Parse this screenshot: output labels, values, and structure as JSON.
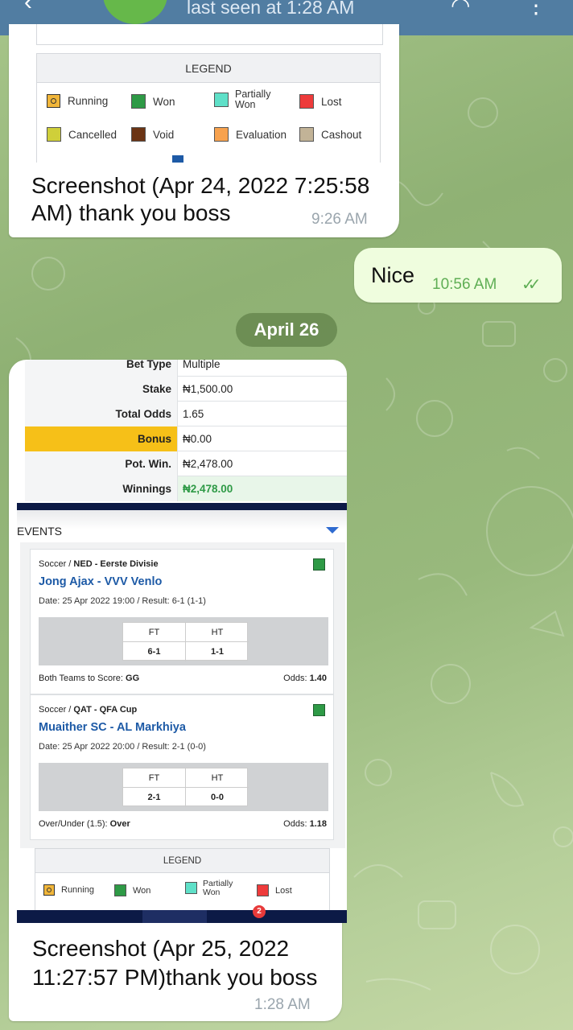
{
  "header": {
    "status": "last seen at 1:28 AM"
  },
  "colors": {
    "header": "#517da2",
    "avatar": "#66b84a",
    "outgoing_bubble": "#effdde",
    "check": "#5fae55",
    "link": "#1d5aa6",
    "bonus": "#f6c018",
    "navy": "#0c1a46"
  },
  "legend_labels": {
    "title": "LEGEND",
    "running": "Running",
    "won": "Won",
    "partially_won": "Partially Won",
    "lost": "Lost",
    "cancelled": "Cancelled",
    "void": "Void",
    "evaluation": "Evaluation",
    "cashout": "Cashout"
  },
  "message1": {
    "caption_line1": "Screenshot (Apr 24, 2022 7:25:58",
    "caption_line2": "AM) thank you boss",
    "time": "9:26 AM"
  },
  "message2": {
    "text": "Nice",
    "time": "10:56 AM",
    "status_icon": "double-check-icon"
  },
  "date_separator": "April 26",
  "message3": {
    "bet": {
      "rows": [
        {
          "label": "Bet Type",
          "value": "Multiple"
        },
        {
          "label": "Stake",
          "value": "₦1,500.00"
        },
        {
          "label": "Total Odds",
          "value": "1.65"
        },
        {
          "label": "Bonus",
          "value": "₦0.00"
        },
        {
          "label": "Pot. Win.",
          "value": "₦2,478.00"
        },
        {
          "label": "Winnings",
          "value": "₦2,478.00"
        }
      ]
    },
    "events_title": "EVENTS",
    "ft_label": "FT",
    "ht_label": "HT",
    "odds_label": "Odds:",
    "events": [
      {
        "sport": "Soccer",
        "league": "NED - Eerste Divisie",
        "teams": "Jong Ajax - VVV Venlo",
        "date_result": "Date: 25 Apr 2022 19:00 / Result: 6-1 (1-1)",
        "ft": "6-1",
        "ht": "1-1",
        "market": "Both Teams to Score:",
        "pick": "GG",
        "odds": "1.40",
        "status": "Won"
      },
      {
        "sport": "Soccer",
        "league": "QAT - QFA Cup",
        "teams": "Muaither SC - AL Markhiya",
        "date_result": "Date: 25 Apr 2022 20:00 / Result: 2-1 (0-0)",
        "ft": "2-1",
        "ht": "0-0",
        "market": "Over/Under (1.5):",
        "pick": "Over",
        "odds": "1.18",
        "status": "Won"
      }
    ],
    "nav_badge": "2",
    "caption_line1": "Screenshot (Apr 25, 2022",
    "caption_line2": "11:27:57 PM)thank you boss",
    "time": "1:28 AM"
  }
}
